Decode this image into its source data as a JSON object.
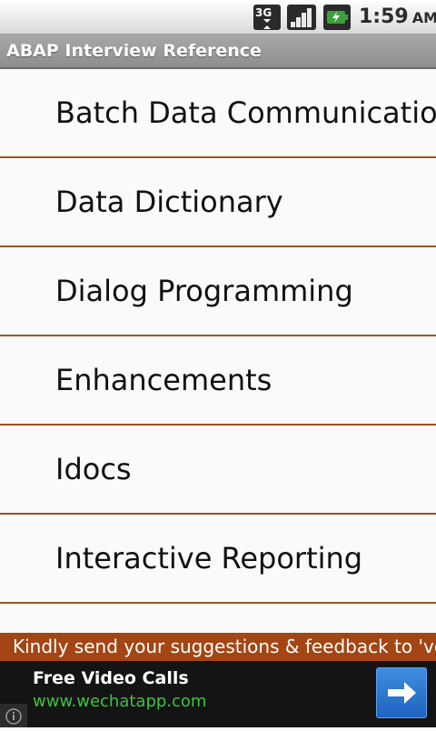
{
  "status_bar": {
    "time": "1:59",
    "ampm": "AM",
    "network_label": "3G"
  },
  "app": {
    "title": "ABAP Interview Reference"
  },
  "list": {
    "items": [
      {
        "label": "Batch Data Communication"
      },
      {
        "label": "Data Dictionary"
      },
      {
        "label": "Dialog Programming"
      },
      {
        "label": "Enhancements"
      },
      {
        "label": "Idocs"
      },
      {
        "label": "Interactive Reporting"
      }
    ]
  },
  "marquee": {
    "text": "Kindly send your suggestions & feedback to 'venug"
  },
  "ad": {
    "title": "Free Video Calls",
    "url": "www.wechatapp.com"
  },
  "colors": {
    "divider": "#a0521e",
    "marquee_bg": "#a34614",
    "ad_url": "#3fc23f",
    "ad_button": "#1e63c1"
  }
}
